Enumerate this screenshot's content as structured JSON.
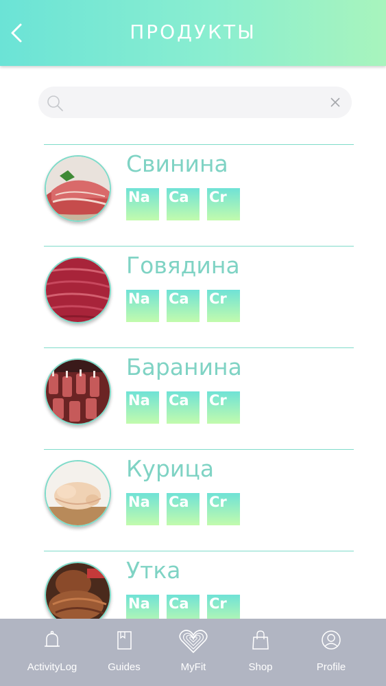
{
  "header": {
    "title": "ПРОДУКТЫ"
  },
  "search": {
    "value": "",
    "placeholder": ""
  },
  "products": [
    {
      "name": "Свинина",
      "minerals": [
        "Na",
        "Ca",
        "Cr"
      ]
    },
    {
      "name": "Говядина",
      "minerals": [
        "Na",
        "Ca",
        "Cr"
      ]
    },
    {
      "name": "Баранина",
      "minerals": [
        "Na",
        "Ca",
        "Cr"
      ]
    },
    {
      "name": "Курица",
      "minerals": [
        "Na",
        "Ca",
        "Cr"
      ]
    },
    {
      "name": "Утка",
      "minerals": [
        "Na",
        "Ca",
        "Cr"
      ]
    }
  ],
  "tabbar": {
    "items": [
      {
        "label": "ActivityLog",
        "icon": "bell-icon"
      },
      {
        "label": "Guides",
        "icon": "book-icon"
      },
      {
        "label": "MyFit",
        "icon": "heart-fingerprint-icon"
      },
      {
        "label": "Shop",
        "icon": "shopping-bag-icon"
      },
      {
        "label": "Profile",
        "icon": "user-circle-icon"
      }
    ]
  },
  "colors": {
    "accent": "#7fd3c4",
    "header_gradient_start": "#6be3d6",
    "header_gradient_end": "#a8f4bd",
    "tabbar_bg": "#b1b5c2"
  }
}
